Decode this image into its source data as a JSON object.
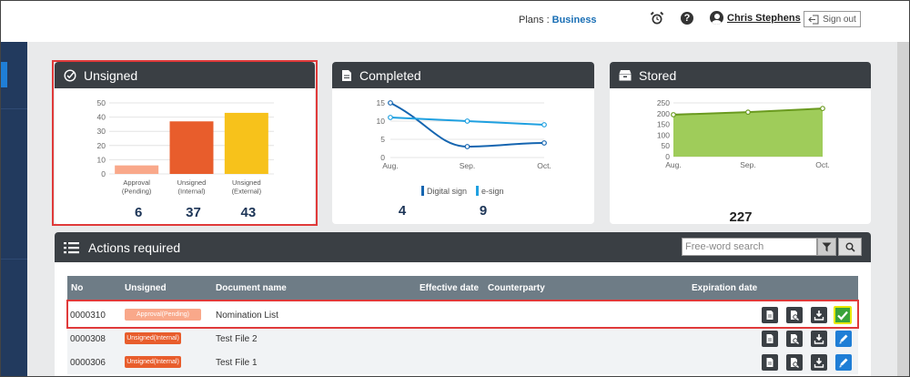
{
  "header": {
    "plans_label": "Plans :",
    "plans_value": "Business",
    "user_name": "Chris Stephens",
    "signout_label": "Sign out"
  },
  "cards": {
    "unsigned": {
      "title": "Unsigned",
      "chart_data": {
        "type": "bar",
        "categories": [
          "Approval (Pending)",
          "Unsigned (Internal)",
          "Unsigned (External)"
        ],
        "category_lines": [
          [
            "Approval",
            "(Pending)"
          ],
          [
            "Unsigned",
            "(Internal)"
          ],
          [
            "Unsigned",
            "(External)"
          ]
        ],
        "values": [
          6,
          37,
          43
        ],
        "colors": [
          "#f9a88a",
          "#e85d2c",
          "#f7c21b"
        ],
        "yticks": [
          0,
          10,
          20,
          30,
          40,
          50
        ],
        "ylim": [
          0,
          50
        ]
      },
      "counts": [
        "6",
        "37",
        "43"
      ]
    },
    "completed": {
      "title": "Completed",
      "chart_data": {
        "type": "line",
        "categories": [
          "Aug.",
          "Sep.",
          "Oct."
        ],
        "series": [
          {
            "name": "Digital sign",
            "values": [
              15,
              3,
              4
            ],
            "color": "#1565b0"
          },
          {
            "name": "e-sign",
            "values": [
              11,
              10,
              9
            ],
            "color": "#1fa0e0"
          }
        ],
        "yticks": [
          0,
          5,
          10,
          15
        ],
        "ylim": [
          0,
          15
        ]
      },
      "legend": [
        "Digital sign",
        "e-sign"
      ],
      "counts": [
        "4",
        "9"
      ]
    },
    "stored": {
      "title": "Stored",
      "chart_data": {
        "type": "area",
        "categories": [
          "Aug.",
          "Sep.",
          "Oct."
        ],
        "series": [
          {
            "values": [
              195,
              207,
              224
            ],
            "color": "#6a9a1f",
            "fill": "#9fcc5a"
          }
        ],
        "yticks": [
          0,
          50,
          100,
          150,
          200,
          250
        ],
        "ylim": [
          0,
          250
        ]
      },
      "count": "227"
    }
  },
  "actions": {
    "title": "Actions required",
    "search_placeholder": "Free-word search",
    "columns": {
      "no": "No",
      "unsigned": "Unsigned",
      "document": "Document name",
      "effective": "Effective date",
      "counterparty": "Counterparty",
      "expiration": "Expiration date"
    },
    "rows": [
      {
        "no": "0000310",
        "status": "Approval(Pending)",
        "status_color": "#f9a88a",
        "document": "Nomination List"
      },
      {
        "no": "0000308",
        "status": "Unsigned(Internal)",
        "status_color": "#e85d2c",
        "document": "Test File 2"
      },
      {
        "no": "0000306",
        "status": "Unsigned(Internal)",
        "status_color": "#e85d2c",
        "document": "Test File 1"
      }
    ]
  }
}
